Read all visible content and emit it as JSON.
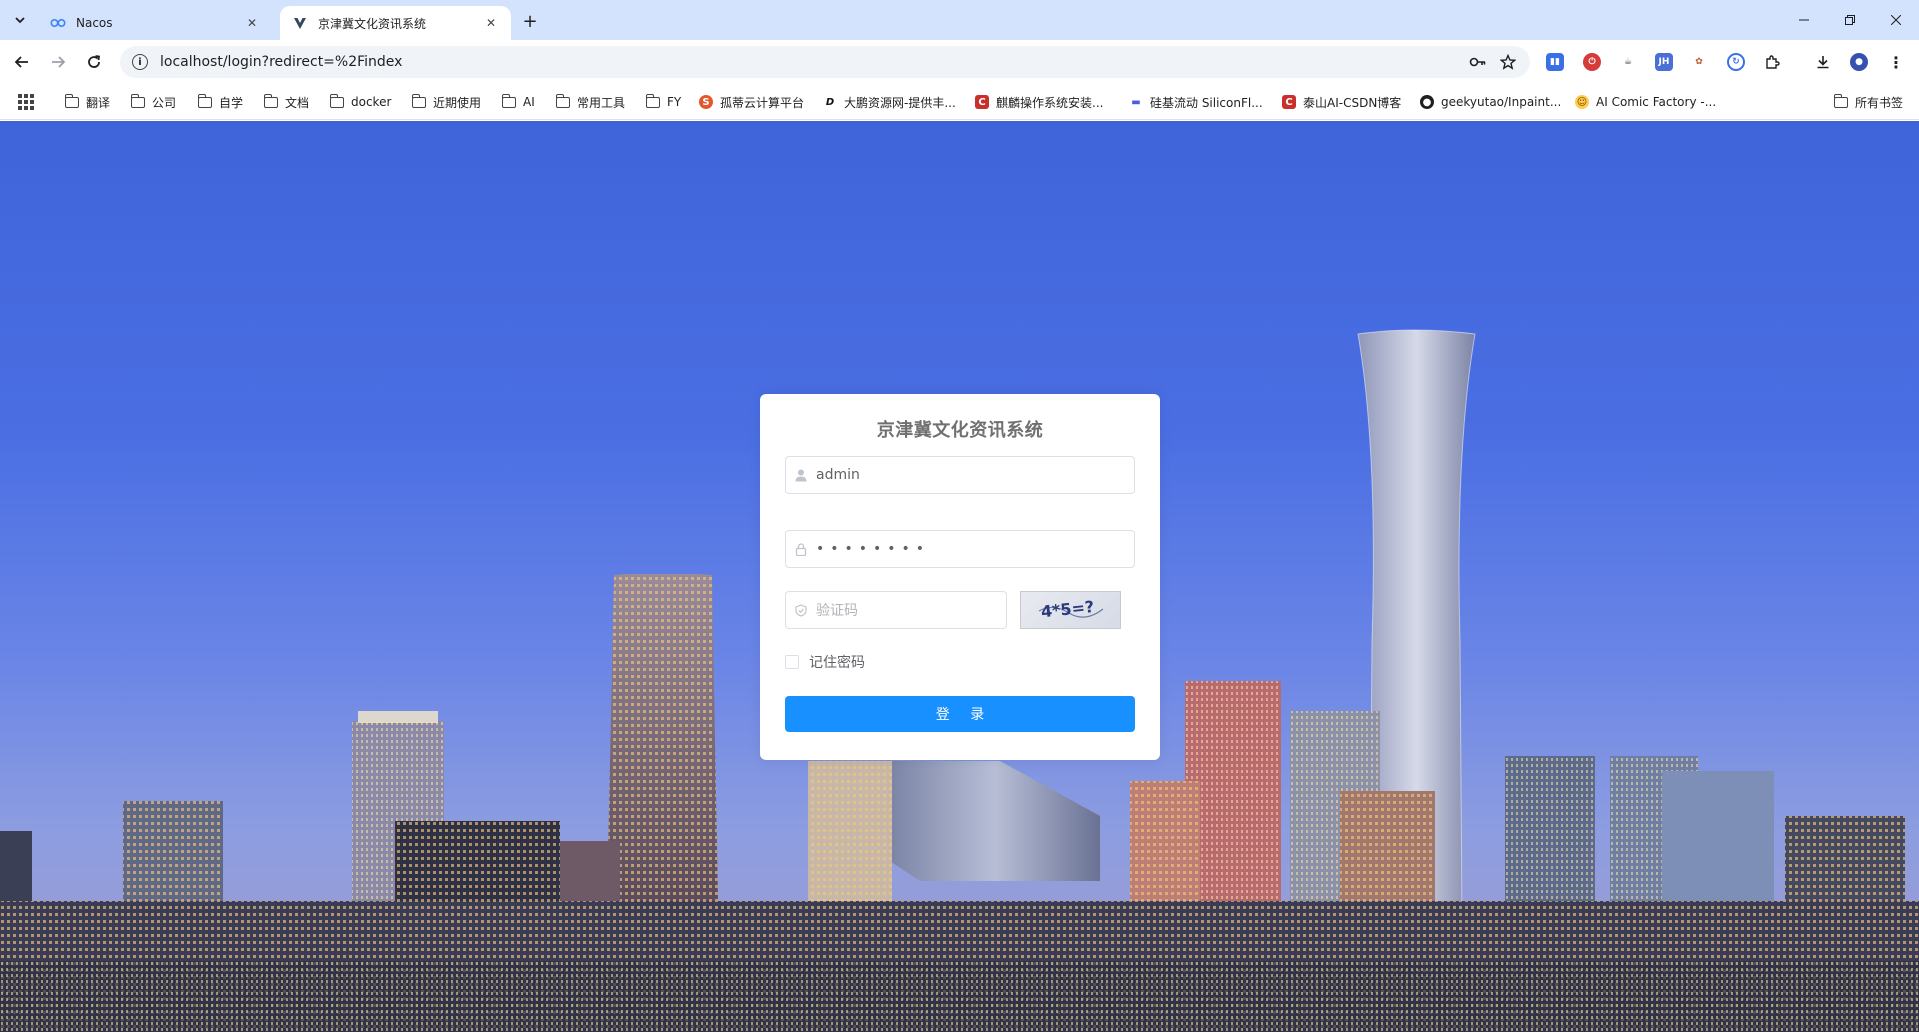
{
  "browser": {
    "tabs": [
      {
        "title": "Nacos",
        "favicon": "nacos-icon"
      },
      {
        "title": "京津冀文化资讯系统",
        "favicon": "vite-icon"
      }
    ],
    "url": "localhost/login?redirect=%2Findex"
  },
  "bookmarks": [
    {
      "label": "翻译",
      "icon": "folder-icon"
    },
    {
      "label": "公司",
      "icon": "folder-icon"
    },
    {
      "label": "自学",
      "icon": "folder-icon"
    },
    {
      "label": "文档",
      "icon": "folder-icon"
    },
    {
      "label": "docker",
      "icon": "folder-icon"
    },
    {
      "label": "近期使用",
      "icon": "folder-icon"
    },
    {
      "label": "AI",
      "icon": "folder-icon"
    },
    {
      "label": "常用工具",
      "icon": "folder-icon"
    },
    {
      "label": "FY",
      "icon": "folder-icon"
    },
    {
      "label": "孤蒂云计算平台",
      "icon": "cloud-logo-icon"
    },
    {
      "label": "大鹏资源网-提供丰...",
      "icon": "d-logo-icon"
    },
    {
      "label": "麒麟操作系统安装...",
      "icon": "csdn-icon"
    },
    {
      "label": "硅基流动 SiliconFl...",
      "icon": "siliconflow-icon"
    },
    {
      "label": "泰山AI-CSDN博客",
      "icon": "csdn-icon"
    },
    {
      "label": "geekyutao/Inpaint...",
      "icon": "github-icon"
    },
    {
      "label": "AI Comic Factory -...",
      "icon": "hf-icon"
    },
    {
      "label": "所有书签",
      "icon": "folder-icon"
    }
  ],
  "login": {
    "title": "京津冀文化资讯系统",
    "username": "admin",
    "password_mask": "••••••••",
    "captcha_placeholder": "验证码",
    "captcha_text": "4*5=?",
    "remember_label": "记住密码",
    "submit_label": "登 录"
  },
  "colors": {
    "primary": "#1890ff",
    "title": "#707070",
    "tabstrip": "#d3e3fd"
  }
}
